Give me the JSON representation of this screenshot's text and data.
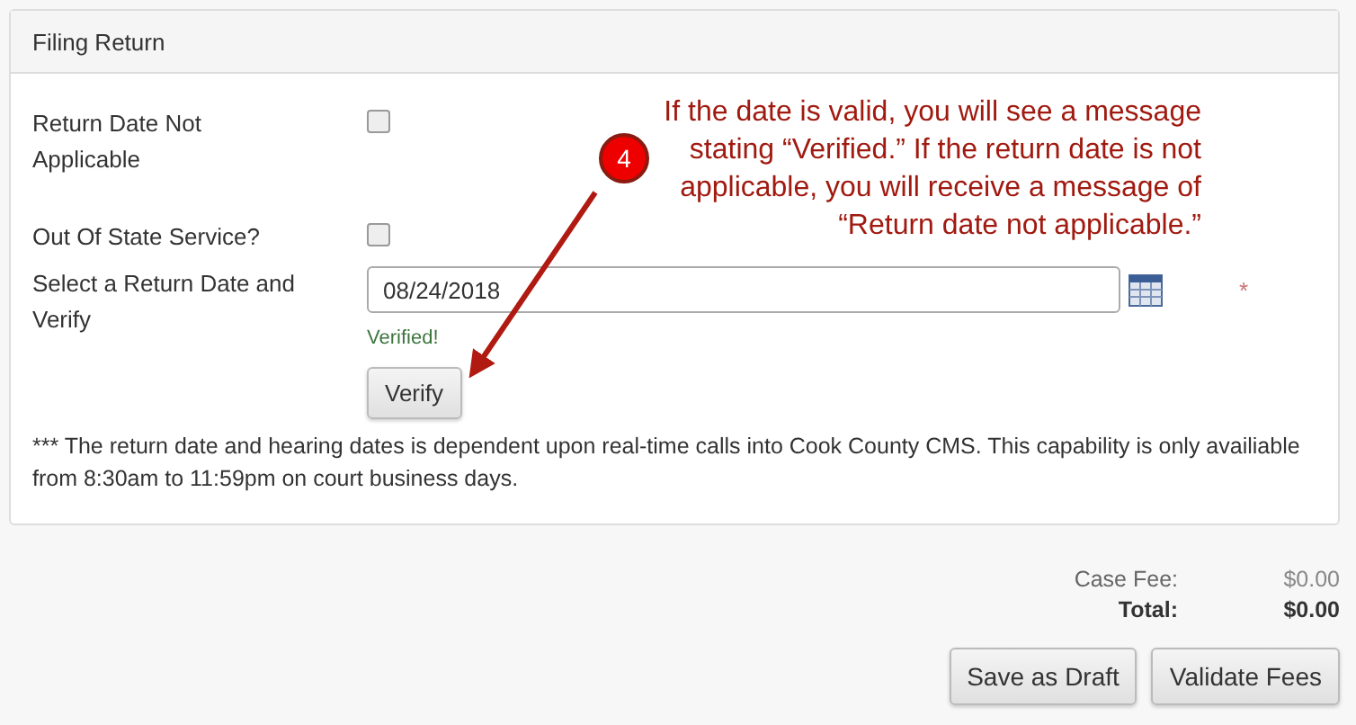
{
  "panel": {
    "title": "Filing Return",
    "fields": [
      {
        "kind": "checkbox",
        "label": "Return Date Not Applicable",
        "checked": false
      },
      {
        "kind": "checkbox",
        "label": "Out Of State Service?",
        "checked": false
      },
      {
        "kind": "date",
        "label": "Select a Return Date and Verify",
        "value": "08/24/2018",
        "required_mark": "*",
        "status": "Verified!",
        "button": "Verify"
      }
    ],
    "note": "*** The return date and hearing dates is dependent upon real-time calls into Cook County CMS. This capability is only availiable from 8:30am to 11:59pm on court business days."
  },
  "fees": [
    {
      "label": "Case Fee:",
      "amount": "$0.00",
      "total": false
    },
    {
      "label": "Total:",
      "amount": "$0.00",
      "total": true
    }
  ],
  "buttons": [
    "Save as Draft",
    "Validate Fees"
  ],
  "annotation": {
    "badge": "4",
    "lines": [
      "If the date is valid, you will see a message",
      "stating “Verified.” If the return date is not",
      "applicable, you will receive a message of",
      "“Return date not applicable.”"
    ]
  }
}
